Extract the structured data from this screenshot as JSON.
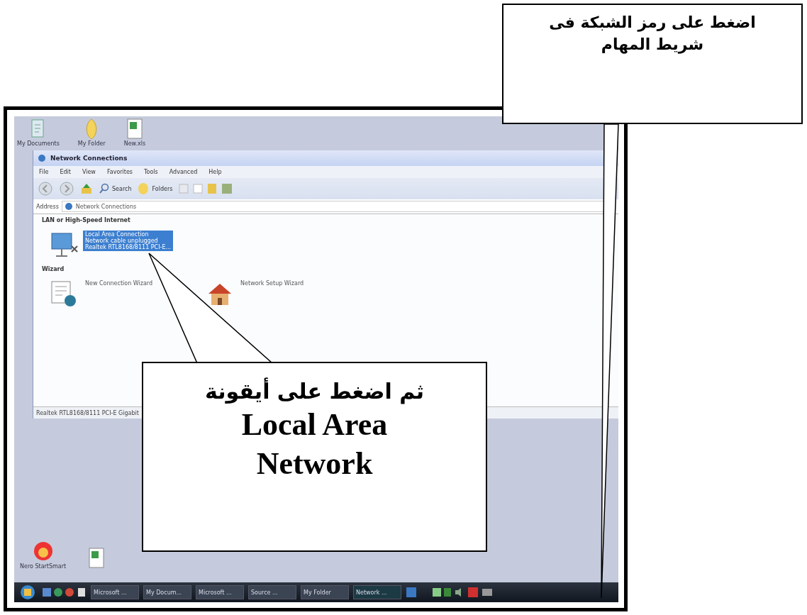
{
  "desktop_icons_top": [
    {
      "label": "My Documents",
      "kind": "document"
    },
    {
      "label": "My Folder",
      "kind": "folder"
    },
    {
      "label": "New.xls",
      "kind": "sheet"
    }
  ],
  "window": {
    "title": "Network Connections",
    "menu": [
      "File",
      "Edit",
      "View",
      "Favorites",
      "Tools",
      "Advanced",
      "Help"
    ],
    "toolbar": [
      {
        "kind": "back"
      },
      {
        "kind": "forward"
      },
      {
        "kind": "up"
      },
      {
        "kind": "search",
        "label": "Search"
      },
      {
        "kind": "folders",
        "label": "Folders"
      }
    ],
    "address": {
      "label": "Address",
      "value": "Network Connections"
    },
    "sections": [
      {
        "title": "LAN or High-Speed Internet",
        "items": [
          {
            "kind": "lan",
            "selected": true,
            "lines": [
              "Local Area Connection",
              "Network cable unplugged",
              "Realtek RTL8168/8111 PCI-E..."
            ]
          }
        ]
      },
      {
        "title": "Wizard",
        "items": [
          {
            "kind": "wizard",
            "selected": false,
            "lines": [
              "New Connection Wizard"
            ]
          },
          {
            "kind": "home",
            "selected": false,
            "lines": [
              "Network Setup Wizard"
            ]
          }
        ]
      }
    ],
    "status_bar": "Realtek RTL8168/8111 PCI-E Gigabit"
  },
  "desktop_icons_bottom": [
    {
      "label": "Nero StartSmart",
      "kind": "nero"
    },
    {
      "kind": "sheet"
    }
  ],
  "taskbar": {
    "buttons": [
      {
        "label": "Microsoft ...",
        "selected": false
      },
      {
        "label": "My Docum...",
        "selected": false
      },
      {
        "label": "Microsoft ...",
        "selected": false
      },
      {
        "label": "Source ...",
        "selected": false
      },
      {
        "label": "My Folder",
        "selected": false
      },
      {
        "label": "Network ...",
        "selected": true
      }
    ]
  },
  "callouts": [
    {
      "text": "اضغط على رمز الشبكة فى شريط المهام"
    },
    {
      "text": "ثم اضغط على أيقونة",
      "subtext": "Local Area Network"
    }
  ]
}
